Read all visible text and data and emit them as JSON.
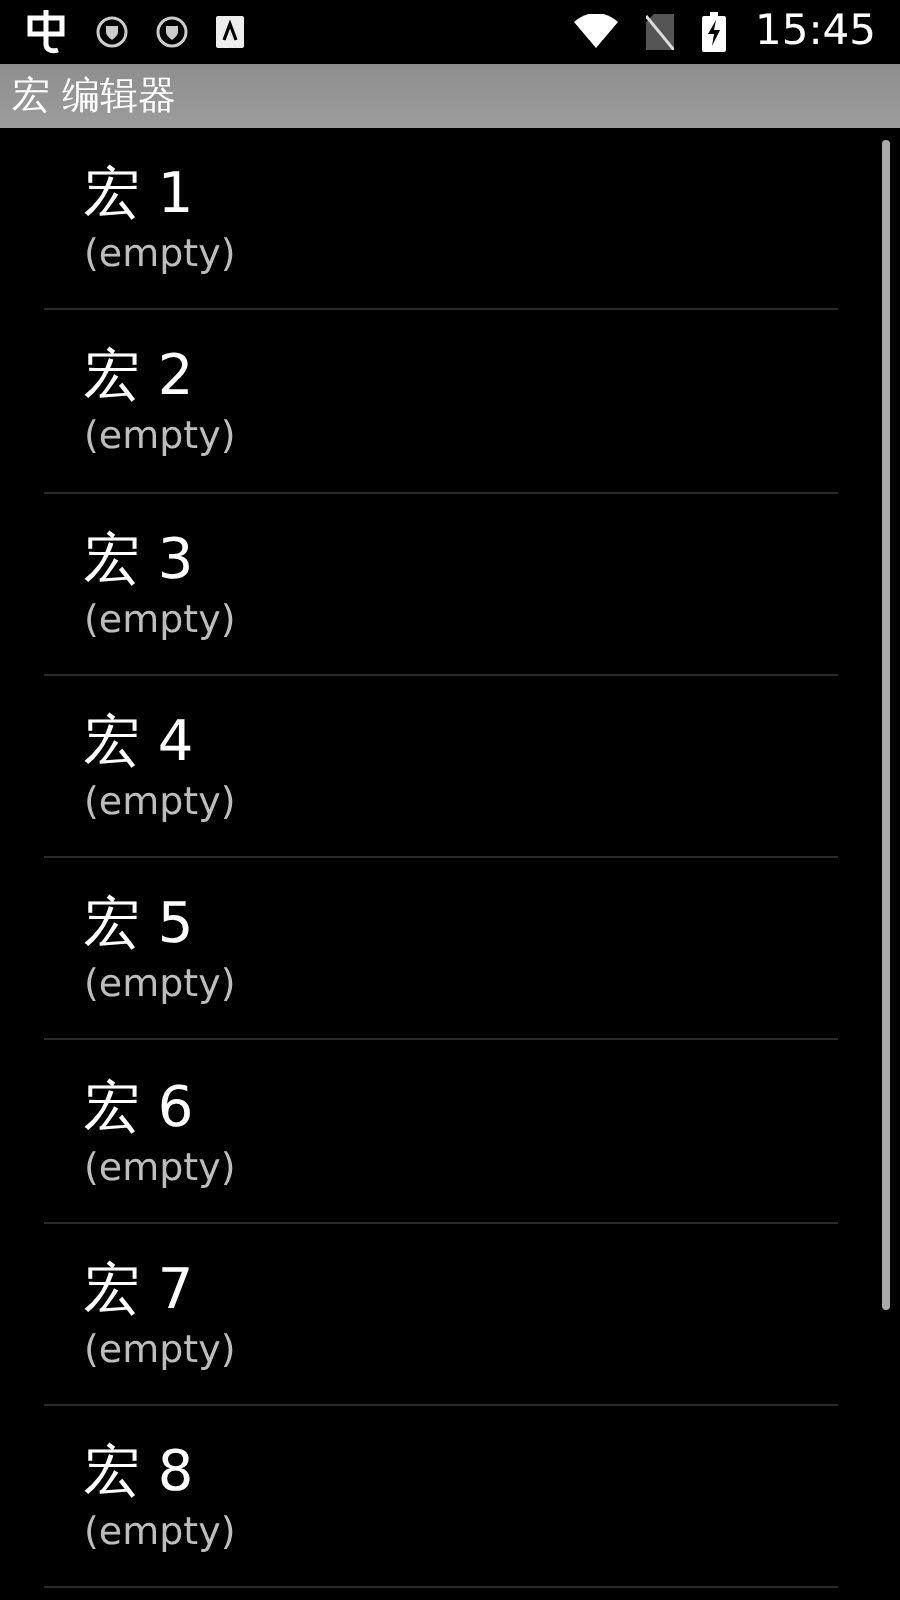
{
  "status_bar": {
    "time": "15:45"
  },
  "title_bar": {
    "title": "宏 编辑器"
  },
  "macros": [
    {
      "name": "宏 1",
      "value": "(empty)"
    },
    {
      "name": "宏 2",
      "value": "(empty)"
    },
    {
      "name": "宏 3",
      "value": "(empty)"
    },
    {
      "name": "宏 4",
      "value": "(empty)"
    },
    {
      "name": "宏 5",
      "value": "(empty)"
    },
    {
      "name": "宏 6",
      "value": "(empty)"
    },
    {
      "name": "宏 7",
      "value": "(empty)"
    },
    {
      "name": "宏 8",
      "value": "(empty)"
    }
  ]
}
